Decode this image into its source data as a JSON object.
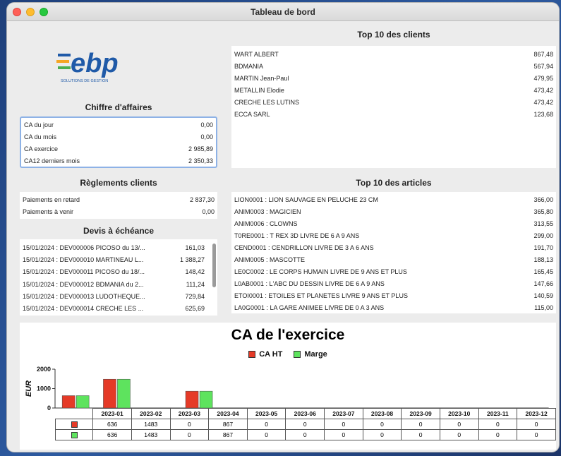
{
  "window": {
    "title": "Tableau de bord"
  },
  "logo": {
    "text": "ebp",
    "subtitle": "SOLUTIONS DE GESTION",
    "colors": [
      "#1f5aa8",
      "#f5a623",
      "#4caf50"
    ]
  },
  "chiffre_affaires": {
    "title": "Chiffre d'affaires",
    "rows": [
      {
        "label": "CA du jour",
        "value": "0,00"
      },
      {
        "label": "CA du mois",
        "value": "0,00"
      },
      {
        "label": "CA exercice",
        "value": "2 985,89"
      },
      {
        "label": "CA12 derniers mois",
        "value": "2 350,33"
      }
    ]
  },
  "reglements": {
    "title": "Règlements clients",
    "rows": [
      {
        "label": "Paiements en retard",
        "value": "2 837,30"
      },
      {
        "label": "Paiements à venir",
        "value": "0,00"
      }
    ]
  },
  "devis": {
    "title": "Devis à échéance",
    "rows": [
      {
        "label": "15/01/2024 : DEV000006 PICOSO du 13/...",
        "value": "161,03"
      },
      {
        "label": "15/01/2024 : DEV000010 MARTINEAU L...",
        "value": "1 388,27"
      },
      {
        "label": "15/01/2024 : DEV000011 PICOSO du 18/...",
        "value": "148,42"
      },
      {
        "label": "15/01/2024 : DEV000012 BDMANIA du 2...",
        "value": "111,24"
      },
      {
        "label": "15/01/2024 : DEV000013 LUDOTHEQUE...",
        "value": "729,84"
      },
      {
        "label": "15/01/2024 : DEV000014 CRECHE LES ...",
        "value": "625,69"
      }
    ]
  },
  "top_clients": {
    "title": "Top 10 des clients",
    "rows": [
      {
        "label": "WART ALBERT",
        "value": "867,48"
      },
      {
        "label": "BDMANIA",
        "value": "567,94"
      },
      {
        "label": "MARTIN Jean-Paul",
        "value": "479,95"
      },
      {
        "label": "METALLIN Elodie",
        "value": "473,42"
      },
      {
        "label": "CRECHE LES LUTINS",
        "value": "473,42"
      },
      {
        "label": "ECCA SARL",
        "value": "123,68"
      }
    ]
  },
  "top_articles": {
    "title": "Top 10 des articles",
    "rows": [
      {
        "label": "LION0001 : LION SAUVAGE EN PELUCHE 23 CM",
        "value": "366,00"
      },
      {
        "label": "ANIM0003 : MAGICIEN",
        "value": "365,80"
      },
      {
        "label": "ANIM0006 : CLOWNS",
        "value": "313,55"
      },
      {
        "label": "T0RE0001 : T REX 3D LIVRE DE 6 A 9 ANS",
        "value": "299,00"
      },
      {
        "label": "CEND0001 : CENDRILLON LIVRE DE 3 A 6 ANS",
        "value": "191,70"
      },
      {
        "label": "ANIM0005 : MASCOTTE",
        "value": "188,13"
      },
      {
        "label": "LE0C0002 : LE CORPS HUMAIN LIVRE DE 9 ANS ET PLUS",
        "value": "165,45"
      },
      {
        "label": "L0AB0001 : L'ABC DU DESSIN LIVRE DE 6 A 9 ANS",
        "value": "147,66"
      },
      {
        "label": "ETOI0001 : ETOILES ET PLANETES LIVRE 9 ANS ET PLUS",
        "value": "140,59"
      },
      {
        "label": "LA0G0001 : LA GARE ANIMEE LIVRE DE 0 A 3 ANS",
        "value": "115,00"
      }
    ]
  },
  "chart_data": {
    "type": "bar",
    "title": "CA de l'exercice",
    "ylabel": "EUR",
    "xlabel": "",
    "ylim": [
      0,
      2000
    ],
    "yticks": [
      "0",
      "1000",
      "2000"
    ],
    "categories": [
      "2023-01",
      "2023-02",
      "2023-03",
      "2023-04",
      "2023-05",
      "2023-06",
      "2023-07",
      "2023-08",
      "2023-09",
      "2023-10",
      "2023-11",
      "2023-12"
    ],
    "series": [
      {
        "name": "CA HT",
        "color": "#e53a27",
        "values": [
          636,
          1483,
          0,
          867,
          0,
          0,
          0,
          0,
          0,
          0,
          0,
          0
        ]
      },
      {
        "name": "Marge",
        "color": "#5ee35e",
        "values": [
          636,
          1483,
          0,
          867,
          0,
          0,
          0,
          0,
          0,
          0,
          0,
          0
        ]
      }
    ],
    "legend": "top-center",
    "grid": false
  }
}
